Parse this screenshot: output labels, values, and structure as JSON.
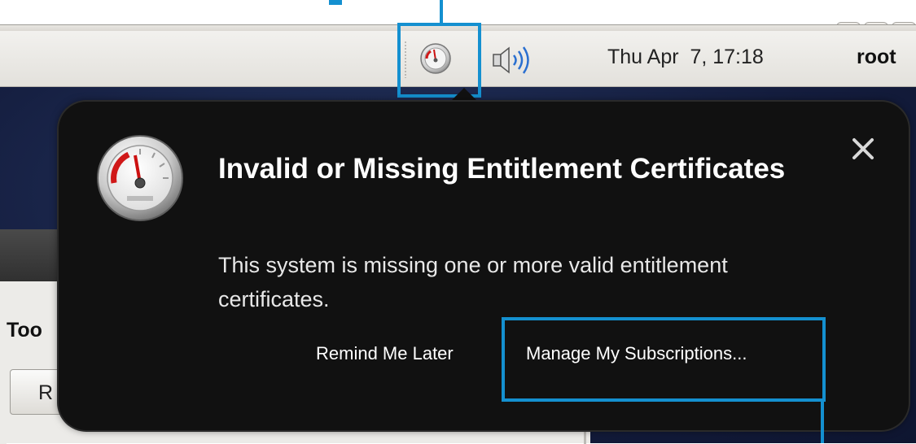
{
  "panel": {
    "clock": "Thu Apr  7, 17:18",
    "user": "root",
    "tray_icons": [
      "subscription-manager-gauge-icon",
      "speaker-volume-icon"
    ]
  },
  "notification": {
    "title": "Invalid or Missing Entitlement Certificates",
    "body": "This system is missing one or more valid entitlement certificates.",
    "actions": {
      "remind": "Remind Me Later",
      "manage": "Manage My Subscriptions..."
    },
    "close_glyph": "close-icon"
  },
  "background_window": {
    "toolbar_label": "Too",
    "button_label": "R"
  },
  "colors": {
    "highlight": "#1490d0",
    "bubble_bg": "#111111",
    "gauge_needle": "#cc1111"
  }
}
